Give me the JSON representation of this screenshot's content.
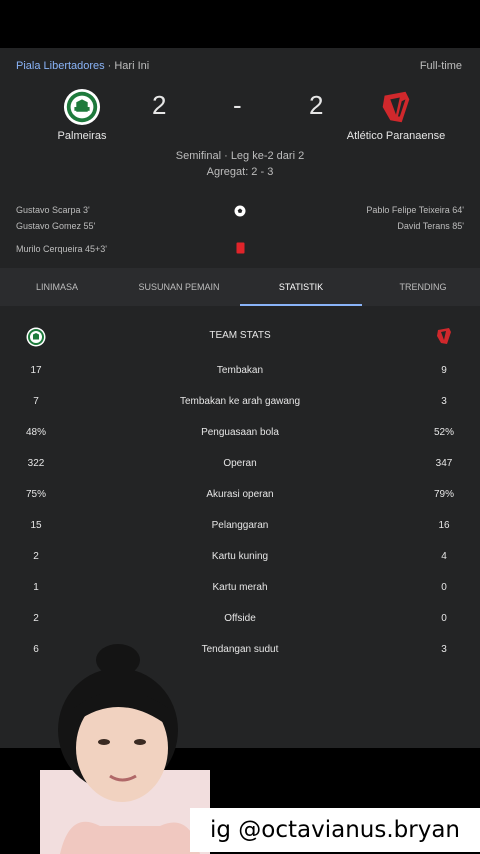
{
  "header": {
    "competition": "Piala Libertadores",
    "separator": "·",
    "day": "Hari Ini",
    "status": "Full-time"
  },
  "match": {
    "home_team": "Palmeiras",
    "away_team": "Atlético Paranaense",
    "home_score": "2",
    "score_separator": "-",
    "away_score": "2",
    "stage": "Semifinal · Leg ke-2 dari 2",
    "aggregate": "Agregat: 2 - 3"
  },
  "events": {
    "home_goals": [
      "Gustavo Scarpa 3'",
      "Gustavo Gomez 55'"
    ],
    "home_cards": [
      "Murilo Cerqueira 45+3'"
    ],
    "away_goals": [
      "Pablo Felipe Teixeira 64'",
      "David Terans 85'"
    ],
    "goal_icon": "soccer-ball-icon",
    "card_icon": "red-card-icon"
  },
  "tabs": [
    {
      "label": "LINIMASA",
      "active": false
    },
    {
      "label": "SUSUNAN PEMAIN",
      "active": false
    },
    {
      "label": "STATISTIK",
      "active": true
    },
    {
      "label": "TRENDING",
      "active": false
    }
  ],
  "stats": {
    "title": "TEAM STATS",
    "rows": [
      {
        "home": "17",
        "label": "Tembakan",
        "away": "9"
      },
      {
        "home": "7",
        "label": "Tembakan ke arah gawang",
        "away": "3"
      },
      {
        "home": "48%",
        "label": "Penguasaan bola",
        "away": "52%"
      },
      {
        "home": "322",
        "label": "Operan",
        "away": "347"
      },
      {
        "home": "75%",
        "label": "Akurasi operan",
        "away": "79%"
      },
      {
        "home": "15",
        "label": "Pelanggaran",
        "away": "16"
      },
      {
        "home": "2",
        "label": "Kartu kuning",
        "away": "4"
      },
      {
        "home": "1",
        "label": "Kartu merah",
        "away": "0"
      },
      {
        "home": "2",
        "label": "Offside",
        "away": "0"
      },
      {
        "home": "6",
        "label": "Tendangan sudut",
        "away": "3"
      }
    ]
  },
  "overlay": {
    "caption": "ig @octavianus.bryan"
  },
  "colors": {
    "background": "#232425",
    "accent": "#8ab4f8",
    "home_green": "#1e7a3c",
    "away_red": "#d0282c"
  }
}
